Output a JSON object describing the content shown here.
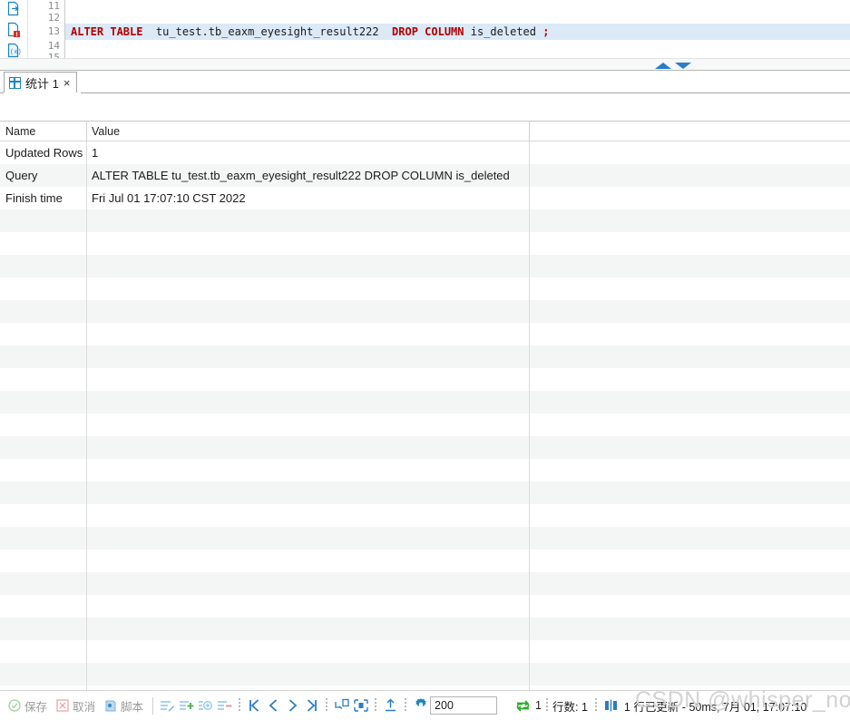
{
  "editor": {
    "line_numbers": [
      "11",
      "12",
      "13",
      "14",
      "15"
    ],
    "sql_keyword_1": "ALTER TABLE",
    "sql_table": "  tu_test.tb_eaxm_eyesight_result222  ",
    "sql_keyword_2": "DROP COLUMN",
    "sql_column": " is_deleted ",
    "sql_semicolon": ";",
    "gutter_icons": [
      "export-sql-icon",
      "sql-error-icon",
      "sql-variables-icon"
    ]
  },
  "splitter": {
    "collapse_up_icon": "triangle-up-icon",
    "collapse_down_icon": "triangle-down-icon"
  },
  "tabs": [
    {
      "label": "统计 1",
      "icon": "grid-icon",
      "close": "×"
    }
  ],
  "result_grid": {
    "columns": [
      "Name",
      "Value"
    ],
    "rows": [
      {
        "name": "Updated Rows",
        "value": "1"
      },
      {
        "name": "Query",
        "value": "ALTER TABLE  tu_test.tb_eaxm_eyesight_result222  DROP COLUMN is_deleted"
      },
      {
        "name": "Finish time",
        "value": "Fri Jul 01 17:07:10 CST 2022"
      }
    ],
    "empty_row_count": 22
  },
  "toolbar": {
    "save_label": "保存",
    "cancel_label": "取消",
    "script_label": "脚本",
    "edit_row_icon": "edit-row-icon",
    "add_row_icon": "add-row-icon",
    "duplicate_row_icon": "duplicate-row-icon",
    "delete_row_icon": "delete-row-icon",
    "first_page_icon": "first-page-icon",
    "prev_page_icon": "prev-page-icon",
    "next_page_icon": "next-page-icon",
    "last_page_icon": "last-page-icon",
    "fetch_next_icon": "fetch-next-page-icon",
    "fetch_all_icon": "fetch-all-rows-icon",
    "export_icon": "export-icon",
    "settings_icon": "gear-icon",
    "fetch_size_value": "200",
    "refresh_icon": "refresh-icon",
    "refresh_count": "1",
    "row_count_label": "行数: 1",
    "status_icon": "columns-icon",
    "status_text": "1 行已更新 - 50ms, 7月 01, 17:07:10"
  },
  "watermark": {
    "text": "CSDN @whisper_node"
  },
  "colors": {
    "keyword": "#b00000",
    "line_highlight": "#dce9f7",
    "accent_blue": "#2a7cc7",
    "row_alt": "#f4f5f5",
    "green": "#3aa93a"
  }
}
